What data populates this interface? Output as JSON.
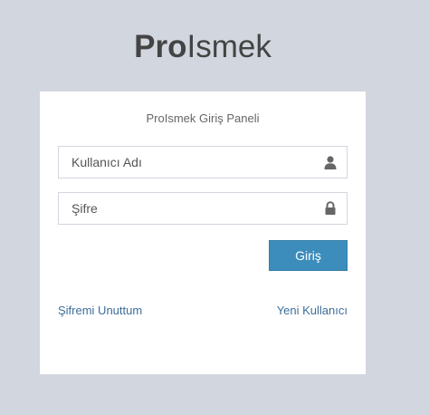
{
  "logo": {
    "bold": "Pro",
    "light": "Ismek"
  },
  "panel": {
    "title": "ProIsmek Giriş Paneli",
    "username": {
      "placeholder": "Kullanıcı Adı",
      "value": ""
    },
    "password": {
      "placeholder": "Şifre",
      "value": ""
    },
    "login_label": "Giriş",
    "forgot_label": "Şifremi Unuttum",
    "register_label": "Yeni Kullanıcı"
  },
  "icons": {
    "username": "user-icon",
    "password": "lock-icon"
  },
  "colors": {
    "background": "#d2d6de",
    "primary_button": "#3c8dbc",
    "link": "#3c6e9a"
  }
}
